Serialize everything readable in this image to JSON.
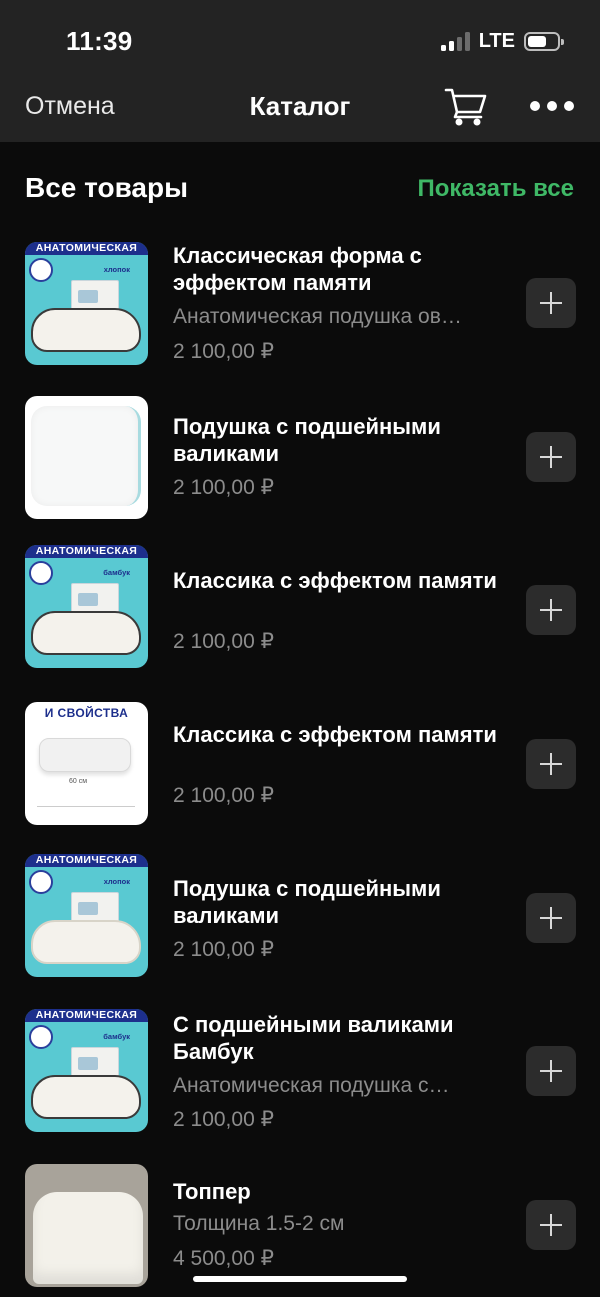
{
  "status_bar": {
    "time": "11:39",
    "network": "LTE",
    "battery_level": 0.65
  },
  "nav": {
    "cancel": "Отмена",
    "title": "Каталог",
    "cart_icon": "cart-icon",
    "more_icon": "more-icon"
  },
  "section": {
    "title": "Все товары",
    "show_all": "Показать все"
  },
  "products": [
    {
      "title": "Классическая форма с эффектом памяти",
      "subtitle": "Анатомическая подушка ов…",
      "price": "2 100,00 ₽",
      "image_label": "АНАТОМИЧЕСКАЯ",
      "image_material": "хлопок"
    },
    {
      "title": "Подушка с подшейными валиками",
      "subtitle": "",
      "price": "2 100,00 ₽"
    },
    {
      "title": "Классика с эффектом памяти",
      "subtitle": "",
      "price": "2 100,00 ₽",
      "image_label": "АНАТОМИЧЕСКАЯ",
      "image_material": "бамбук"
    },
    {
      "title": "Классика с эффектом памяти",
      "subtitle": "",
      "price": "2 100,00 ₽",
      "image_label": "И СВОЙСТВА"
    },
    {
      "title": "Подушка с подшейными валиками",
      "subtitle": "",
      "price": "2 100,00 ₽",
      "image_label": "АНАТОМИЧЕСКАЯ",
      "image_material": "хлопок"
    },
    {
      "title": "С подшейными валиками Бамбук",
      "subtitle": "Анатомическая подушка с…",
      "price": "2 100,00 ₽",
      "image_label": "АНАТОМИЧЕСКАЯ",
      "image_material": "бамбук"
    },
    {
      "title": "Топпер",
      "subtitle": "Толщина 1.5-2 см",
      "price": "4 500,00 ₽"
    }
  ],
  "colors": {
    "background": "#0b0b0b",
    "header": "#232323",
    "accent": "#3fb866",
    "secondary_text": "#8c8c8c",
    "button": "#2c2c2c"
  }
}
